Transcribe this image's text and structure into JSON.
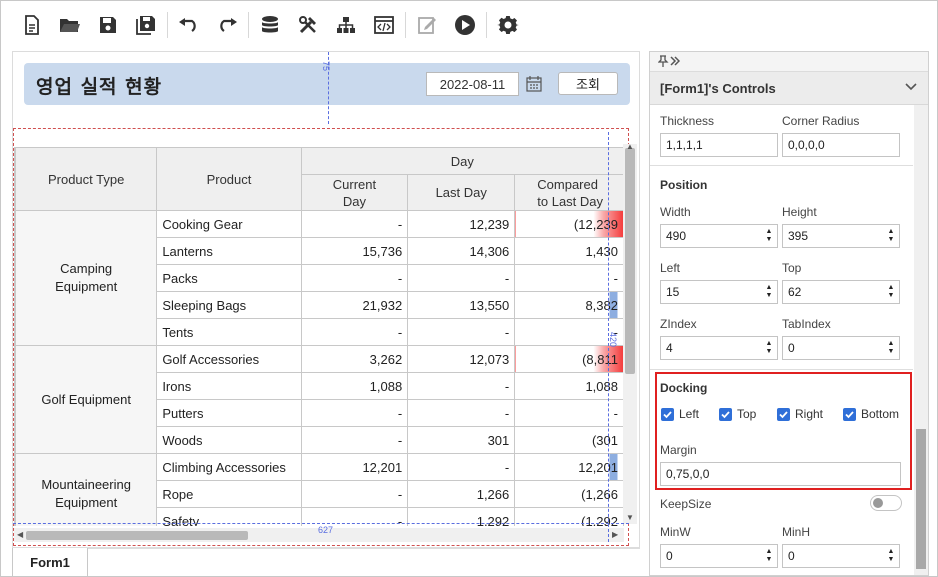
{
  "toolbar": {
    "buttons": [
      "new-file",
      "open-folder",
      "save",
      "save-all",
      "undo",
      "redo",
      "database",
      "tools",
      "hierarchy",
      "code-view",
      "edit",
      "run",
      "settings"
    ]
  },
  "form": {
    "header_title": "영업 실적 현황",
    "date_value": "2022-08-11",
    "query_button": "조회",
    "guide_top": "75",
    "guide_bottom": "627",
    "guide_right": "420",
    "tab_label": "Form1"
  },
  "grid": {
    "headers": {
      "product_type": "Product Type",
      "product": "Product",
      "day": "Day",
      "current_day": "Current\nDay",
      "last_day": "Last Day",
      "compared": "Compared\nto Last Day"
    },
    "groups": [
      {
        "category": "Camping\nEquipment",
        "rows": [
          {
            "product": "Cooking Gear",
            "current": "-",
            "last": "12,239",
            "compared": "(12,239",
            "bar": "red"
          },
          {
            "product": "Lanterns",
            "current": "15,736",
            "last": "14,306",
            "compared": "1,430",
            "bar": ""
          },
          {
            "product": "Packs",
            "current": "-",
            "last": "-",
            "compared": "-",
            "bar": ""
          },
          {
            "product": "Sleeping Bags",
            "current": "21,932",
            "last": "13,550",
            "compared": "8,382",
            "bar": "blue"
          },
          {
            "product": "Tents",
            "current": "-",
            "last": "-",
            "compared": "-",
            "bar": ""
          }
        ]
      },
      {
        "category": "Golf Equipment",
        "rows": [
          {
            "product": "Golf Accessories",
            "current": "3,262",
            "last": "12,073",
            "compared": "(8,811",
            "bar": "red"
          },
          {
            "product": "Irons",
            "current": "1,088",
            "last": "-",
            "compared": "1,088",
            "bar": ""
          },
          {
            "product": "Putters",
            "current": "-",
            "last": "-",
            "compared": "-",
            "bar": ""
          },
          {
            "product": "Woods",
            "current": "-",
            "last": "301",
            "compared": "(301",
            "bar": ""
          }
        ]
      },
      {
        "category": "Mountaineering\nEquipment",
        "rows": [
          {
            "product": "Climbing Accessories",
            "current": "12,201",
            "last": "-",
            "compared": "12,201",
            "bar": "blue"
          },
          {
            "product": "Rope",
            "current": "-",
            "last": "1,266",
            "compared": "(1,266",
            "bar": ""
          },
          {
            "product": "Safety",
            "current": "-",
            "last": "1,292",
            "compared": "(1,292",
            "bar": ""
          }
        ]
      }
    ]
  },
  "panel": {
    "title": "[Form1]'s Controls",
    "thickness_label": "Thickness",
    "thickness_value": "1,1,1,1",
    "corner_label": "Corner Radius",
    "corner_value": "0,0,0,0",
    "position_label": "Position",
    "width_label": "Width",
    "width_value": "490",
    "height_label": "Height",
    "height_value": "395",
    "left_label": "Left",
    "left_value": "15",
    "top_label": "Top",
    "top_value": "62",
    "zindex_label": "ZIndex",
    "zindex_value": "4",
    "tabindex_label": "TabIndex",
    "tabindex_value": "0",
    "docking_label": "Docking",
    "dock_left": "Left",
    "dock_top": "Top",
    "dock_right": "Right",
    "dock_bottom": "Bottom",
    "margin_label": "Margin",
    "margin_value": "0,75,0,0",
    "keepsize_label": "KeepSize",
    "minw_label": "MinW",
    "minw_value": "0",
    "minh_label": "MinH",
    "minh_value": "0"
  }
}
